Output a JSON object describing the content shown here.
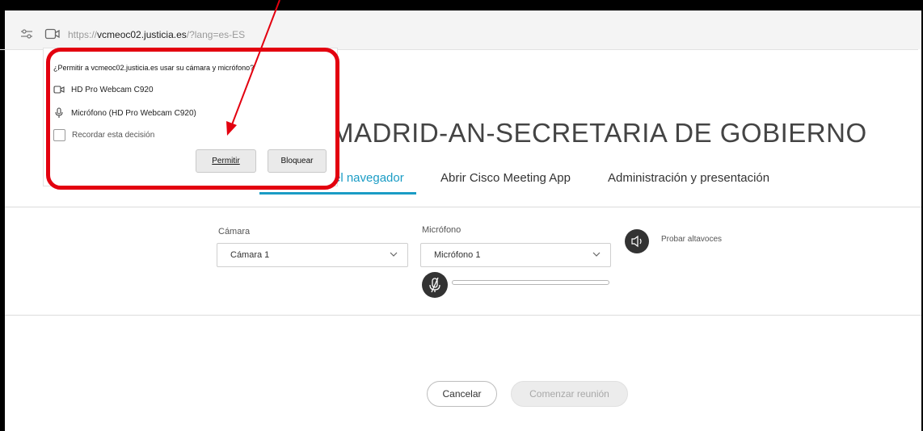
{
  "browser": {
    "url_prefix": "https://",
    "url_domain": "vcmeoc02.justicia.es",
    "url_path": "/?lang=es-ES"
  },
  "permission_popup": {
    "question": "¿Permitir a vcmeoc02.justicia.es usar su cámara y micrófono?",
    "camera_device": "HD Pro Webcam C920",
    "microphone_device": "Micrófono (HD Pro Webcam C920)",
    "remember_label": "Recordar esta decisión",
    "remember_checked": false,
    "allow_button": "Permitir",
    "block_button": "Bloquear"
  },
  "meeting": {
    "title": "MADRID-AN-SECRETARIA DE GOBIERNO",
    "tabs": [
      {
        "label": "el navegador",
        "active": true
      },
      {
        "label": "Abrir Cisco Meeting App",
        "active": false
      },
      {
        "label": "Administración y presentación",
        "active": false
      }
    ]
  },
  "devices": {
    "camera_label": "Cámara",
    "camera_value": "Cámara 1",
    "microphone_label": "Micrófono",
    "microphone_value": "Micrófono 1",
    "test_speakers": "Probar altavoces",
    "mic_level": 0
  },
  "actions": {
    "cancel": "Cancelar",
    "start": "Comenzar reunión"
  },
  "colors": {
    "accent": "#1a9cc5",
    "highlight": "#e3000f",
    "dark_button": "#333333"
  }
}
